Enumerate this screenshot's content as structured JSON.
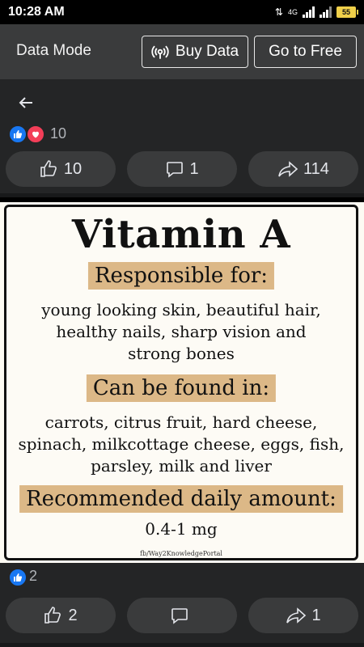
{
  "status_bar": {
    "time": "10:28 AM",
    "network": "4G",
    "battery": "55"
  },
  "data_bar": {
    "mode_label": "Data Mode",
    "buy_label": "Buy Data",
    "free_label": "Go to Free"
  },
  "post1": {
    "reaction_count": "10",
    "like_count": "10",
    "comment_count": "1",
    "share_count": "114"
  },
  "poster": {
    "title": "Vitamin A",
    "section1_heading": "Responsible for:",
    "section1_lines": [
      "young looking skin, beautiful hair,",
      "healthy nails, sharp vision and",
      "strong bones"
    ],
    "section2_heading": "Can be found in:",
    "section2_lines": [
      "carrots, citrus fruit, hard cheese,",
      "spinach, milkcottage cheese, eggs, fish,",
      "parsley, milk and liver"
    ],
    "section3_heading": "Recommended daily amount:",
    "section3_value": "0.4-1 mg",
    "credit": "fb/Way2KnowledgePortal"
  },
  "post2": {
    "reaction_count": "2",
    "like_count": "2",
    "comment_count": "",
    "share_count": "1"
  },
  "colors": {
    "like_blue": "#1877f2",
    "love_red": "#f33e58",
    "highlight": "#dcb887"
  }
}
